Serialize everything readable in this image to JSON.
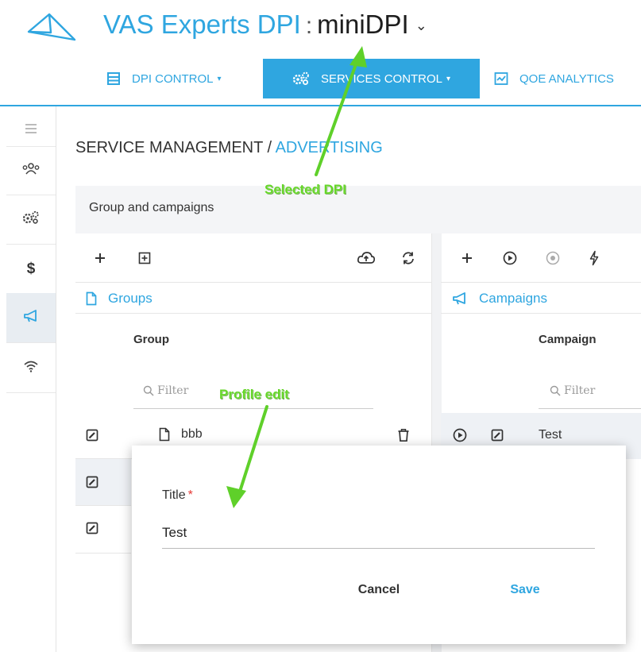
{
  "header": {
    "product_title": "VAS Experts DPI",
    "separator": ":",
    "dpi_name": "miniDPI",
    "dpi_chevron": "⌄",
    "logo_icon": "paper-plane-logo-icon"
  },
  "nav": {
    "items": [
      {
        "label": "DPI CONTROL",
        "icon": "server-icon",
        "caret": "▾",
        "active": false
      },
      {
        "label": "SERVICES CONTROL",
        "icon": "gears-icon",
        "caret": "▾",
        "active": true
      },
      {
        "label": "QOE ANALYTICS",
        "icon": "chart-icon",
        "active": false
      }
    ],
    "accent_color": "#2fa6e0"
  },
  "sidebar": {
    "items": [
      {
        "icon": "menu-icon"
      },
      {
        "icon": "users-icon"
      },
      {
        "icon": "gears-icon"
      },
      {
        "icon": "dollar-icon",
        "glyph": "$"
      },
      {
        "icon": "megaphone-icon",
        "active": true
      },
      {
        "icon": "wifi-icon"
      }
    ]
  },
  "breadcrumb": {
    "parent": "SERVICE MANAGEMENT",
    "separator": " / ",
    "current": "ADVERTISING"
  },
  "panel": {
    "title": "Group and campaigns"
  },
  "groups": {
    "section_label": "Groups",
    "column_header": "Group",
    "filter_placeholder": "Filter",
    "rows": [
      {
        "name": "bbb"
      }
    ]
  },
  "campaigns": {
    "section_label": "Campaigns",
    "column_header": "Campaign",
    "filter_placeholder": "Filter",
    "rows": [
      {
        "name": "Test"
      }
    ]
  },
  "dialog": {
    "title_label": "Title",
    "required_mark": "*",
    "title_value": "Test",
    "cancel_label": "Cancel",
    "save_label": "Save"
  },
  "annotations": {
    "selected_dpi": "Selected DPI",
    "profile_edit": "Profile edit",
    "color": "#65d628"
  }
}
